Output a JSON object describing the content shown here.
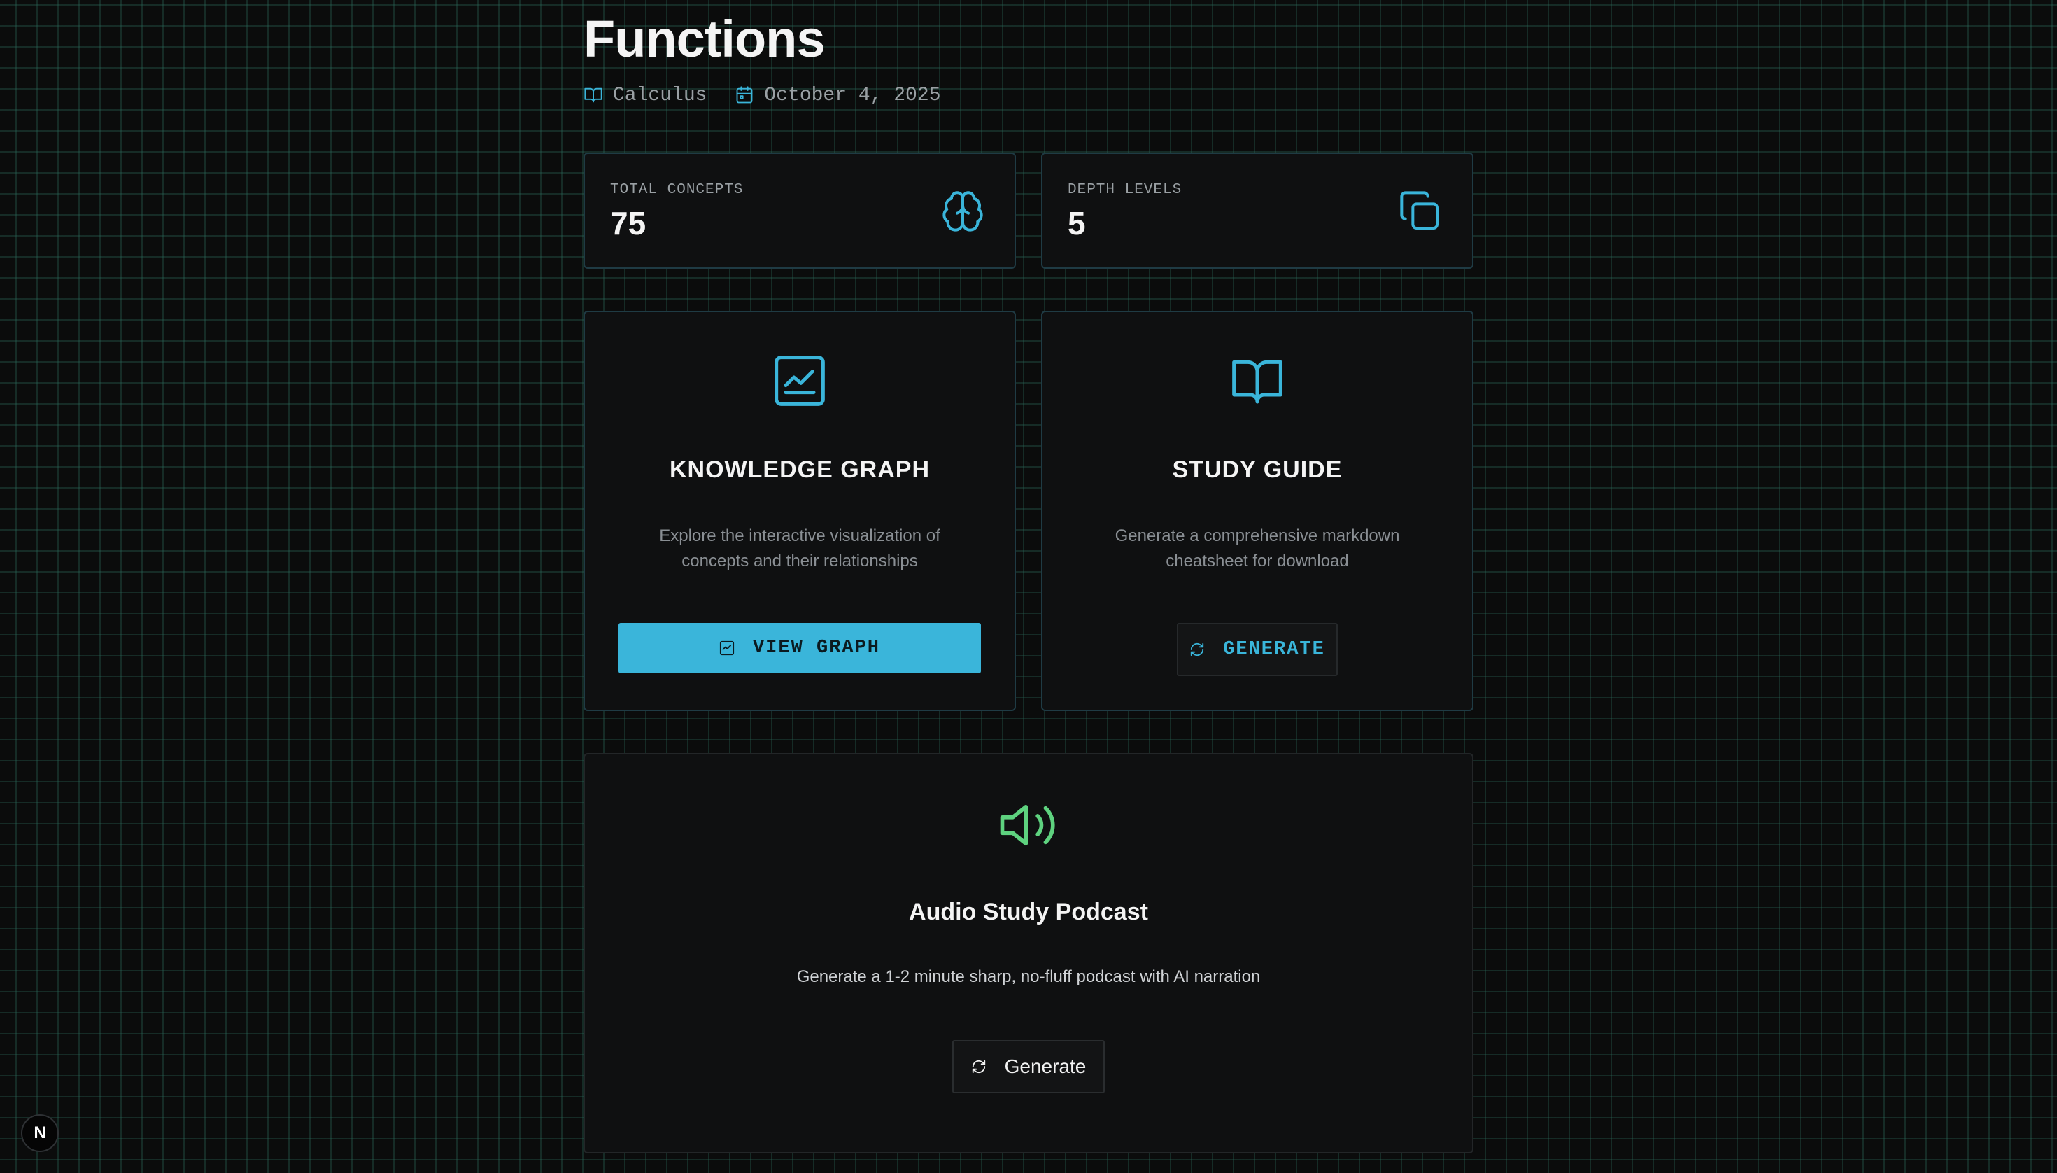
{
  "page": {
    "title": "Functions"
  },
  "meta": {
    "subject": "Calculus",
    "date": "October 4, 2025",
    "subject_icon": "book-open-icon",
    "date_icon": "calendar-icon"
  },
  "stats": [
    {
      "label": "TOTAL CONCEPTS",
      "value": "75",
      "icon": "brain-icon"
    },
    {
      "label": "DEPTH LEVELS",
      "value": "5",
      "icon": "layers-copy-icon"
    }
  ],
  "features": {
    "knowledge_graph": {
      "title": "KNOWLEDGE GRAPH",
      "description": "Explore the interactive visualization of concepts and their relationships",
      "button_label": "VIEW GRAPH",
      "icon": "chart-line-icon"
    },
    "study_guide": {
      "title": "STUDY GUIDE",
      "description": "Generate a comprehensive markdown cheatsheet for download",
      "button_label": "GENERATE",
      "icon": "book-open-icon"
    }
  },
  "podcast": {
    "title": "Audio Study Podcast",
    "description": "Generate a 1-2 minute sharp, no-fluff podcast with AI narration",
    "button_label": "Generate",
    "icon": "volume-icon"
  },
  "dev_badge": {
    "label": "N"
  },
  "colors": {
    "accent": "#3ab5da",
    "podcast_icon": "#5ed27f",
    "background": "#0b0c0c",
    "card_background": "#0f1011",
    "card_border": "#1f3b44"
  }
}
